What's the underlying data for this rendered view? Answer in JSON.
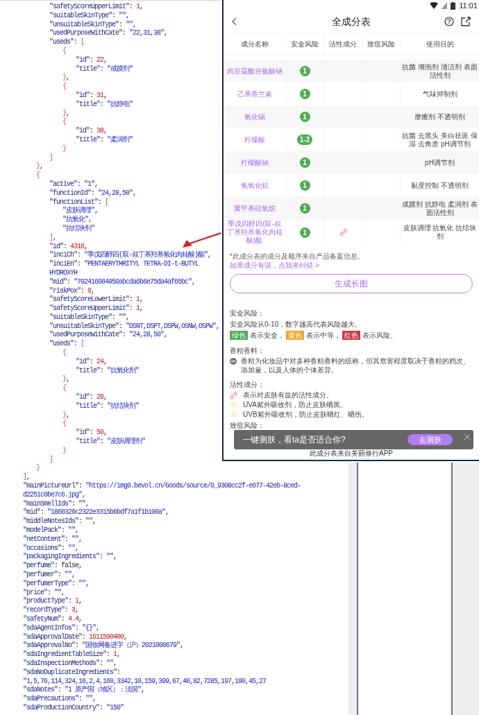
{
  "code_listing": {
    "lines": [
      {
        "children": [
          {
            "children": [
              {
                "text": "\"safetyScoreUpperLimit\": 1,"
              },
              {
                "text": "\"suitableSkinType\": \"\","
              },
              {
                "text": "\"unsuitableSkinType\": \"\","
              },
              {
                "text": "\"usedPurposeWithCate\": \"22,31,38\","
              },
              {
                "text": "\"useds\": [",
                "children": [
                  {
                    "text": "{",
                    "children": [
                      {
                        "text": "\"id\": 22,"
                      },
                      {
                        "text": "\"title\": \"成膜剂\""
                      }
                    ]
                  },
                  {
                    "text": "},"
                  },
                  {
                    "text": "{",
                    "children": [
                      {
                        "text": "\"id\": 31,"
                      },
                      {
                        "text": "\"title\": \"抗静电\""
                      }
                    ]
                  },
                  {
                    "text": "},"
                  },
                  {
                    "text": "{",
                    "children": [
                      {
                        "text": "\"id\": 38,"
                      },
                      {
                        "text": "\"title\": \"柔润剂\""
                      }
                    ]
                  },
                  {
                    "text": "}"
                  }
                ]
              },
              {
                "text": "]"
              }
            ]
          },
          {
            "text": "},"
          },
          {
            "text": "{",
            "children": [
              {
                "text": "\"active\": \"1\","
              },
              {
                "text": "\"functionId\": \"24,28,50\","
              },
              {
                "text": "\"functionList\": [",
                "children": [
                  {
                    "text": "\"皮肤调理\","
                  },
                  {
                    "text": "\"抗氧化\","
                  },
                  {
                    "text": "\"抗结块剂\""
                  }
                ]
              },
              {
                "text": "],"
              },
              {
                "text": "\"id\": 4318,"
              },
              {
                "text": "\"inciCh\": \"季戊四醇四(双-叔丁基羟基氢化肉桂酸)酯\","
              },
              {
                "text": "\"inciEn\": \"PENTAERYTHRITYL TETRA-DI-t-BUTYL HYDROXYH"
              },
              {
                "text": "\"mid\": \"702416084950abcda6b6e75da4af65bc\","
              },
              {
                "text": "\"riskPox\": 0,"
              },
              {
                "text": "\"safetyScoreLowerLimit\": 1,"
              },
              {
                "text": "\"safetyScoreUpperLimit\": 1,"
              },
              {
                "text": "\"suitableSkinType\": \"\","
              },
              {
                "text": "\"unsuitableSkinType\": \"DSNT,DSPT,DSPW,OSNW,OSPW\","
              },
              {
                "text": "\"usedPurposeWithCate\": \"24,28,50\","
              },
              {
                "text": "\"useds\": [",
                "children": [
                  {
                    "text": "{",
                    "children": [
                      {
                        "text": "\"id\": 24,"
                      },
                      {
                        "text": "\"title\": \"抗氧化剂\""
                      }
                    ]
                  },
                  {
                    "text": "},"
                  },
                  {
                    "text": "{",
                    "children": [
                      {
                        "text": "\"id\": 28,"
                      },
                      {
                        "text": "\"title\": \"抗结块剂\""
                      }
                    ]
                  },
                  {
                    "text": "},"
                  },
                  {
                    "text": "{",
                    "children": [
                      {
                        "text": "\"id\": 50,"
                      },
                      {
                        "text": "\"title\": \"皮肤调理剂\""
                      }
                    ]
                  },
                  {
                    "text": "}"
                  }
                ]
              },
              {
                "text": "]"
              }
            ]
          },
          {
            "text": "}"
          }
        ]
      },
      {
        "text": "],"
      },
      {
        "text": "\"mainPictureUrl\": \"https://img0.bevol.cn/Goods/source/0_9308cc2f-e077-42eb-8ced-d2251c0be7c6.jpg\","
      },
      {
        "text": "\"mainSmellIds\": \"\","
      },
      {
        "text": "\"mid\": \"1860326c2322e3315b6bdf7a1f1b100a\","
      },
      {
        "text": "\"middleNotesIds\": \"\","
      },
      {
        "text": "\"modelPack\": \"\","
      },
      {
        "text": "\"netContent\": \"\","
      },
      {
        "text": "\"occasions\": \"\","
      },
      {
        "text": "\"packagingIngredients\": \"\","
      },
      {
        "text": "\"perfume\": false,"
      },
      {
        "text": "\"perfumer\": \"\","
      },
      {
        "text": "\"perfumerType\": \"\","
      },
      {
        "text": "\"price\": \"\","
      },
      {
        "text": "\"productType\": 1,"
      },
      {
        "text": "\"recordType\": 3,"
      },
      {
        "text": "\"safetyNum\": 4.4,"
      },
      {
        "text": "\"sdaAgentInfos\": \"{}\","
      },
      {
        "text": "\"sdaApprovalDate\": 1611590400,"
      },
      {
        "text": "\"sdaApprovalNo\": \"国妆网备进字（沪）2021000679\","
      },
      {
        "text": "\"sdaIngredientTableSize\": 1,"
      },
      {
        "text": "\"sdaInspectionMethods\": \"\","
      },
      {
        "text": "\"sdaNoDuplicateIngredients\": \"1,5,76,114,324,16,2,4,160,3342,10,159,399,67,40,82,7285,197,190,45,27"
      },
      {
        "text": "\"sdaNotes\": \"1 原产国（地区）：法国\","
      },
      {
        "text": "\"sdaPrecautions\": \"\","
      },
      {
        "text": "\"sdaProductionCountry\": \"150\""
      }
    ]
  },
  "phone": {
    "status_bar": {
      "time": "11:01"
    },
    "header": {
      "title": "全成分表"
    },
    "table": {
      "columns": [
        "成分名称",
        "安全风险",
        "活性成分",
        "致痘风险",
        "使用目的"
      ],
      "rows": [
        {
          "name": "肉豆蔻酰谷氨酸钠",
          "safety": "1",
          "active": false,
          "purposes": "抗菌 增泡剂 清洁剂 表面活性剂"
        },
        {
          "name": "乙基香兰素",
          "safety": "1",
          "active": false,
          "purposes": "气味抑制剂"
        },
        {
          "name": "氧化锡",
          "safety": "1",
          "active": false,
          "purposes": "摩擦剂 不透明剂"
        },
        {
          "name": "柠檬酸",
          "safety": "1-2",
          "active": false,
          "purposes": "抗菌 去黑头 美白祛斑 保湿 去角质 pH调节剂"
        },
        {
          "name": "柠檬酸钠",
          "safety": "1",
          "active": false,
          "purposes": "pH调节剂"
        },
        {
          "name": "氢氧化铝",
          "safety": "1",
          "active": false,
          "purposes": "黏度控制 不透明剂"
        },
        {
          "name": "聚甲基硅氧烷",
          "safety": "1",
          "active": false,
          "purposes": "成膜剂 抗静电 柔润剂 表面活性剂"
        },
        {
          "name": "季戊四醇四(双-叔丁基羟基氢化肉桂酸)酯",
          "safety": "1",
          "active": true,
          "purposes": "皮肤调理 抗氧化 抗结块剂"
        }
      ]
    },
    "note": "*此成分表的成分及顺序来自产品备案信息。",
    "correction_link": "如果成分有误，点我来纠错 >",
    "generate_button": "生成长图",
    "legend": {
      "safety_title": "安全风险：",
      "safety_desc": "安全风险从0-10，数字越高代表风险越大。",
      "safety_tags": [
        {
          "label": "绿色",
          "color": "#4caf50",
          "text": "表示安全，"
        },
        {
          "label": "黄色",
          "color": "#f5a623",
          "text": "表示中等，"
        },
        {
          "label": "红色",
          "color": "#d0393e",
          "text": "表示风险。"
        }
      ],
      "fragrance_title": "香精香料：",
      "fragrance_desc": "香精为化妆品中对多种香精香料的统称，但其危害程度取决于香精的档次、添加量，以及人体的个体差异。",
      "active_title": "活性成分：",
      "active_items": [
        {
          "kind": "active",
          "text": "表示对皮肤有益的活性成分。"
        },
        {
          "kind": "sun",
          "text": "UVA紫外吸收剂，防止皮肤晒黑。"
        },
        {
          "kind": "sun",
          "text": "UVB紫外吸收剂，防止皮肤晒红、晒伤。"
        }
      ],
      "acne_title": "致痘风险："
    },
    "promo": {
      "text": "一键测肤，看ta是否适合你?",
      "button": "去测肤"
    },
    "footer": "此成分表来自美丽修行APP"
  }
}
